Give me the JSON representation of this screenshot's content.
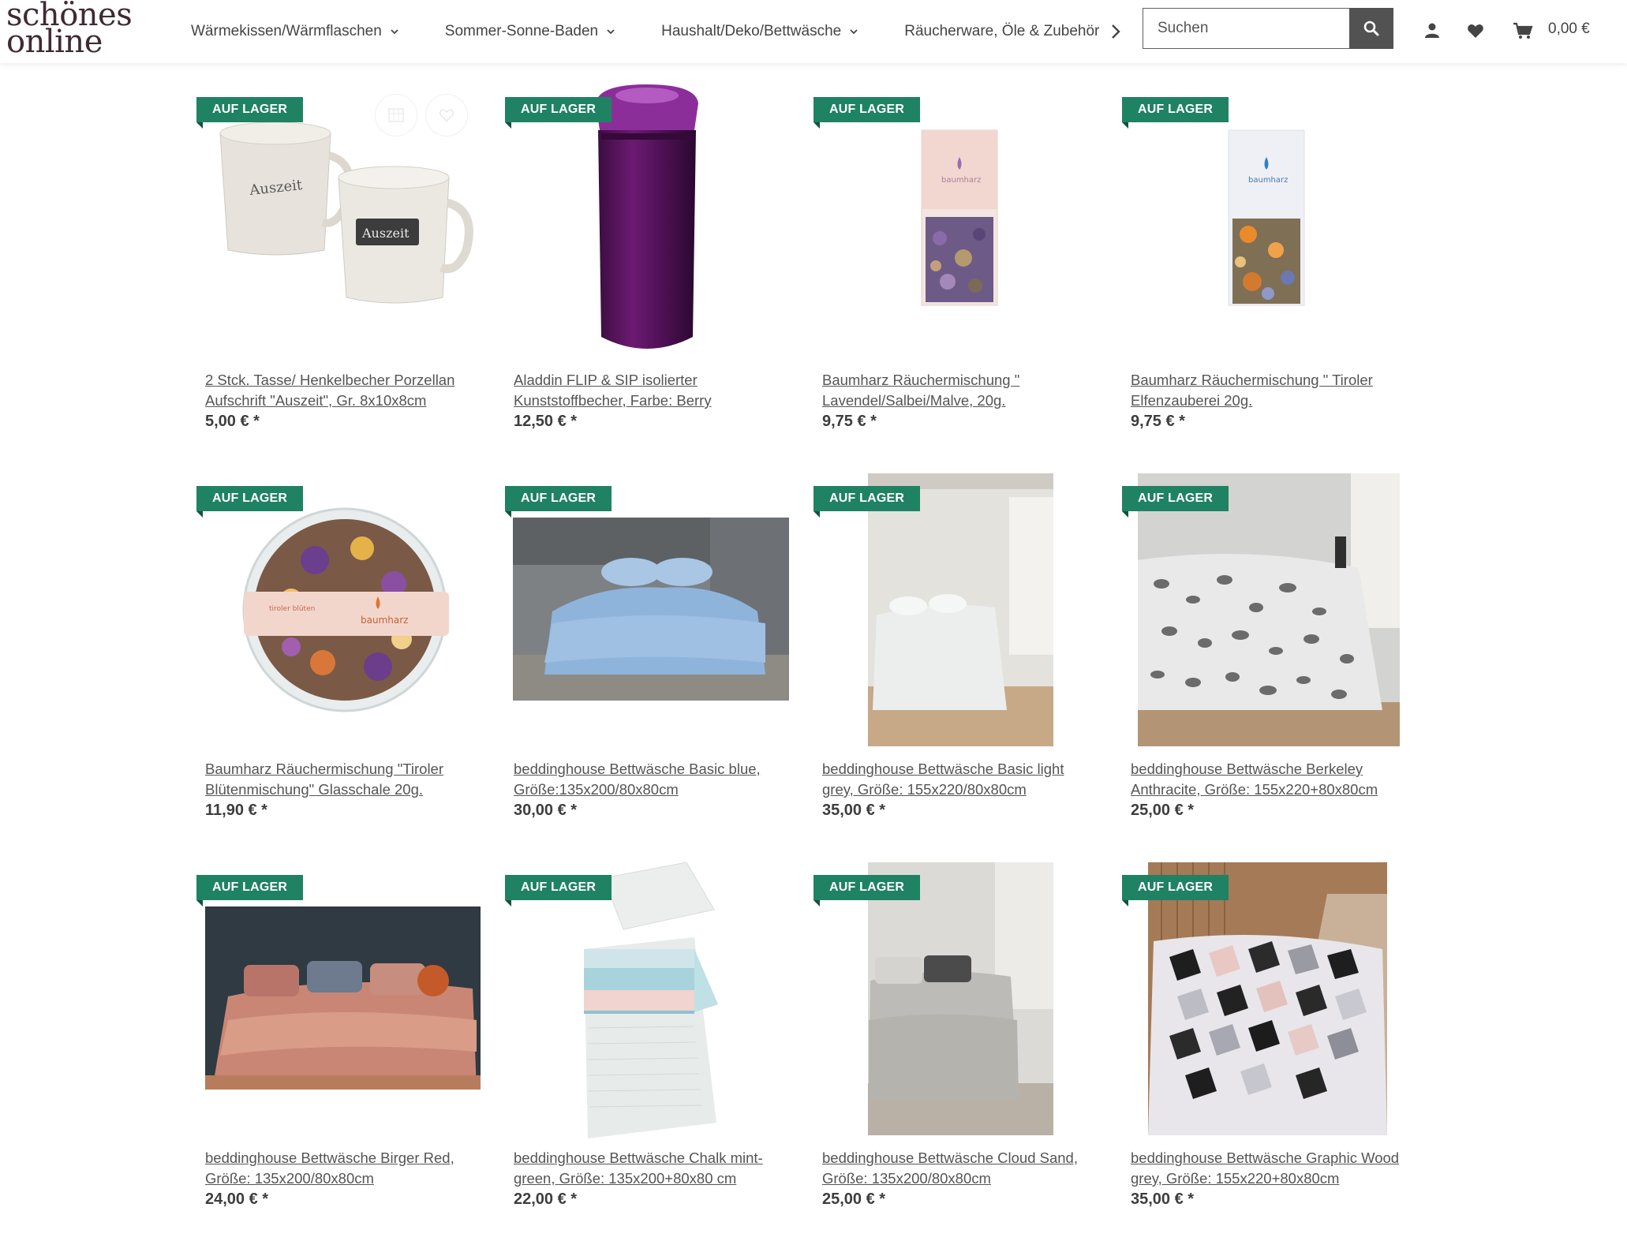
{
  "header": {
    "logo_line1": "schönes",
    "logo_line2": "online",
    "nav": [
      {
        "label": "Wärmekissen/Wärmflaschen"
      },
      {
        "label": "Sommer-Sonne-Baden"
      },
      {
        "label": "Haushalt/Deko/Bettwäsche"
      },
      {
        "label": "Räucherware, Öle & Zubehör"
      }
    ],
    "search_placeholder": "Suchen",
    "cart_total": "0,00 €"
  },
  "badge_label": "AUF LAGER",
  "products": [
    {
      "title": "2 Stck. Tasse/ Henkelbecher Porzellan Aufschrift \"Auszeit\", Gr. 8x10x8cm",
      "price": "5,00 € *",
      "image": "mugs"
    },
    {
      "title": "Aladdin FLIP & SIP isolierter Kunststoffbecher, Farbe: Berry",
      "price": "12,50 € *",
      "image": "bottle"
    },
    {
      "title": "Baumharz Räuchermischung \" Lavendel/Salbei/Malve, 20g.",
      "price": "9,75 € *",
      "image": "bag-lavender"
    },
    {
      "title": "Baumharz Räuchermischung \" Tiroler Elfenzauberei 20g.",
      "price": "9,75 € *",
      "image": "bag-tiroler"
    },
    {
      "title": "Baumharz Räuchermischung \"Tiroler Blütenmischung\" Glasschale 20g.",
      "price": "11,90 € *",
      "image": "bowl"
    },
    {
      "title": "beddinghouse Bettwäsche Basic blue, Größe:135x200/80x80cm",
      "price": "30,00 € *",
      "image": "bed-blue"
    },
    {
      "title": "beddinghouse Bettwäsche Basic light grey, Größe: 155x220/80x80cm",
      "price": "35,00 € *",
      "image": "bed-lightgrey"
    },
    {
      "title": "beddinghouse Bettwäsche Berkeley Anthracite, Größe: 155x220+80x80cm",
      "price": "25,00 € *",
      "image": "bed-leopard"
    },
    {
      "title": "beddinghouse Bettwäsche Birger Red, Größe: 135x200/80x80cm",
      "price": "24,00 € *",
      "image": "bed-red"
    },
    {
      "title": "beddinghouse Bettwäsche Chalk mint-green, Größe: 135x200+80x80 cm",
      "price": "22,00 € *",
      "image": "bed-chalk"
    },
    {
      "title": "beddinghouse Bettwäsche Cloud Sand, Größe: 135x200/80x80cm",
      "price": "25,00 € *",
      "image": "bed-sand"
    },
    {
      "title": "beddinghouse Bettwäsche Graphic Wood grey, Größe: 155x220+80x80cm",
      "price": "35,00 € *",
      "image": "bed-graphic"
    }
  ],
  "colors": {
    "badge": "#1f8263",
    "logo": "#3f2a34",
    "search_button": "#525252"
  }
}
